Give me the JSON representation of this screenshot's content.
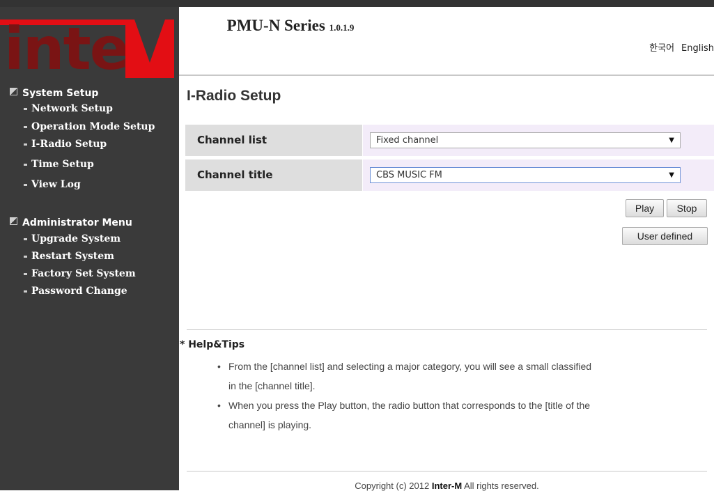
{
  "logo": {
    "text": "inter",
    "letter": "M"
  },
  "header": {
    "title": "PMU-N Series",
    "version": "1.0.1.9",
    "lang_ko": "한국어",
    "lang_en": "English"
  },
  "sidebar": {
    "system_head": "System Setup",
    "system_items": [
      "Network Setup",
      "Operation Mode Setup",
      "I-Radio Setup",
      "Time Setup",
      "View Log"
    ],
    "admin_head": "Administrator Menu",
    "admin_items": [
      "Upgrade System",
      "Restart System",
      "Factory Set System",
      "Password Change"
    ]
  },
  "main": {
    "heading": "I-Radio Setup",
    "channel_list_label": "Channel list",
    "channel_list_value": "Fixed channel",
    "channel_title_label": "Channel title",
    "channel_title_value": "CBS MUSIC FM",
    "play": "Play",
    "stop": "Stop",
    "user_defined": "User defined"
  },
  "help": {
    "heading": "* Help&Tips",
    "tip1a": "From the [channel list] and selecting a major category, you will see a small classified",
    "tip1b": "in the [channel title].",
    "tip2a": "When you press the Play button, the radio button that corresponds to the [title of the",
    "tip2b": "channel] is playing."
  },
  "footer": {
    "pre": "Copyright (c) 2012 ",
    "brand": "Inter-M",
    "post": " All rights reserved."
  },
  "colors": {
    "sidebar": "#3a3a3a",
    "brand_red": "#e30e14",
    "label_bg": "#dedede",
    "value_bg": "#f3ecf9"
  }
}
